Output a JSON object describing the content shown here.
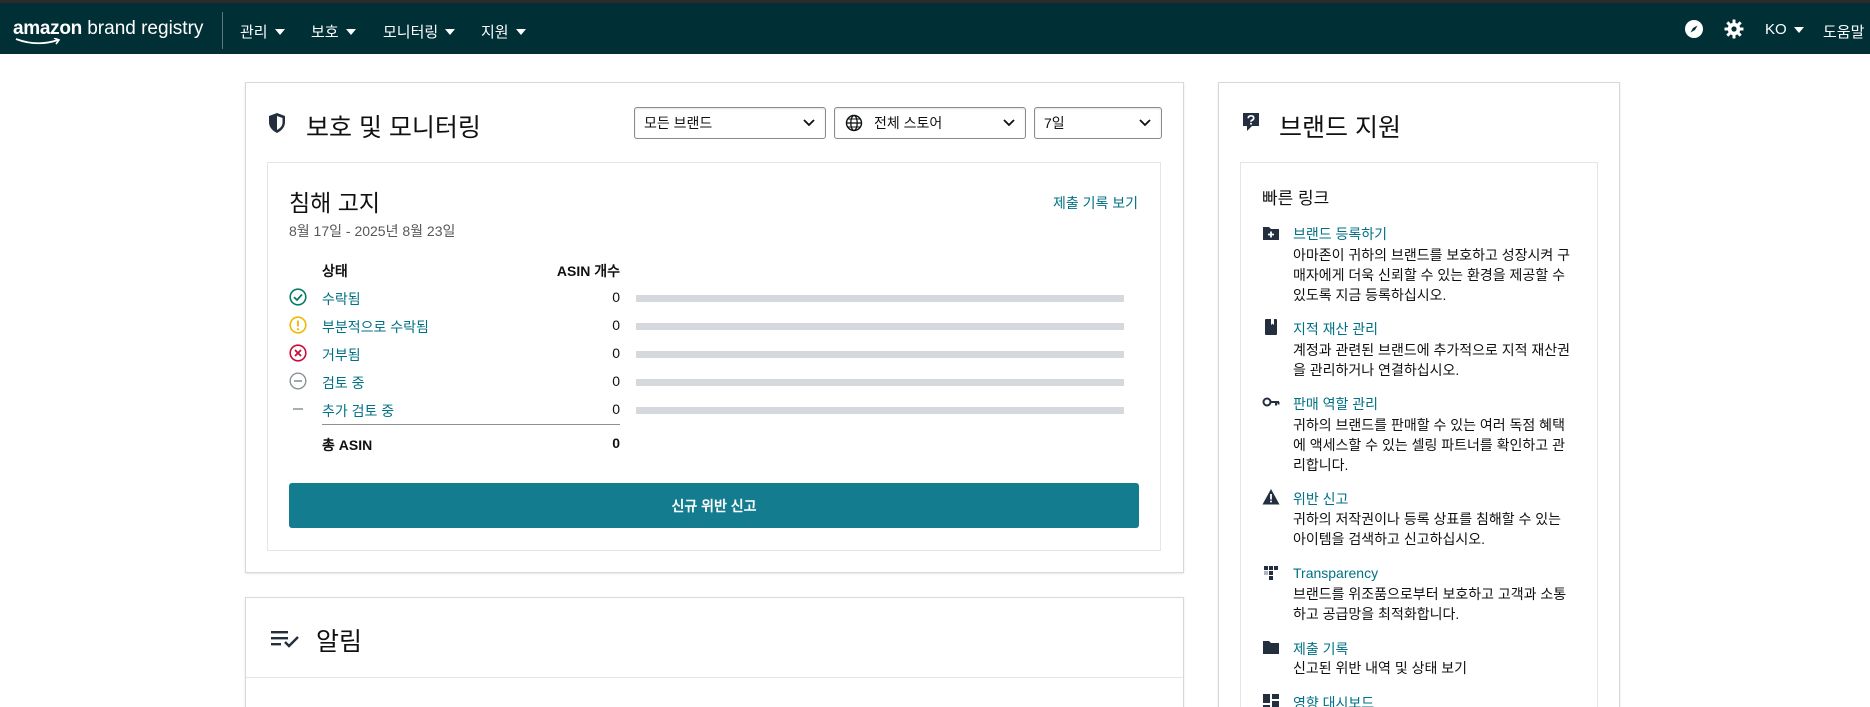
{
  "header": {
    "logo_amazon": "amazon",
    "logo_rest": " brand registry",
    "nav": [
      "관리",
      "보호",
      "모니터링",
      "지원"
    ],
    "right": {
      "compass_icon": "compass-icon",
      "settings_icon": "gear-icon",
      "language": "KO",
      "help": "도움말"
    }
  },
  "protection": {
    "title": "보호 및 모니터링",
    "filters": {
      "brand": "모든 브랜드",
      "store": "전체 스토어",
      "period": "7일"
    },
    "notices": {
      "title": "침해 고지",
      "date_range": "8월 17일 - 2025년 8월 23일",
      "history_link": "제출 기록 보기",
      "col_status": "상태",
      "col_count": "ASIN 개수",
      "rows": [
        {
          "label": "수락됨",
          "count": "0",
          "icon": "check-circle-icon",
          "color": "#067d62"
        },
        {
          "label": "부분적으로 수락됨",
          "count": "0",
          "icon": "alert-circle-icon",
          "color": "#f0b800"
        },
        {
          "label": "거부됨",
          "count": "0",
          "icon": "x-circle-icon",
          "color": "#cc0c39"
        },
        {
          "label": "검토 중",
          "count": "0",
          "icon": "minus-circle-icon",
          "color": "#879596"
        },
        {
          "label": "추가 검토 중",
          "count": "0",
          "icon": "dash-icon",
          "color": "#879596"
        }
      ],
      "total_label": "총 ASIN",
      "total_value": "0",
      "new_report_button": "신규 위반 신고"
    }
  },
  "alerts": {
    "title": "알림"
  },
  "brand_support": {
    "title": "브랜드 지원",
    "quick_links_title": "빠른 링크",
    "links": [
      {
        "title": "브랜드 등록하기",
        "icon": "folder-plus-icon",
        "desc": [
          "아마존이 귀하의 브랜드를 보호하고 성장시켜 구",
          "매자에게 더욱 신뢰할 수 있는 환경을 제공할 수",
          "있도록 지금 등록하십시오."
        ]
      },
      {
        "title": "지적 재산 관리",
        "icon": "book-icon",
        "desc": [
          "계정과 관련된 브랜드에 추가적으로 지적 재산권",
          "을 관리하거나 연결하십시오."
        ]
      },
      {
        "title": "판매 역할 관리",
        "icon": "key-icon",
        "desc": [
          "귀하의 브랜드를 판매할 수 있는 여러 독점 혜택",
          "에 액세스할 수 있는 셀링 파트너를 확인하고 관",
          "리합니다."
        ]
      },
      {
        "title": "위반 신고",
        "icon": "warning-icon",
        "desc": [
          "귀하의 저작권이나 등록 상표를 침해할 수 있는",
          "아이템을 검색하고 신고하십시오."
        ]
      },
      {
        "title": "Transparency",
        "icon": "transparency-icon",
        "desc": [
          "브랜드를 위조품으로부터 보호하고 고객과 소통",
          "하고 공급망을 최적화합니다."
        ]
      },
      {
        "title": "제출 기록",
        "icon": "folder-icon",
        "desc": [
          "신고된 위반 내역 및 상태 보기"
        ]
      },
      {
        "title": "영향 대시보드",
        "icon": "dashboard-icon",
        "desc": []
      }
    ]
  }
}
